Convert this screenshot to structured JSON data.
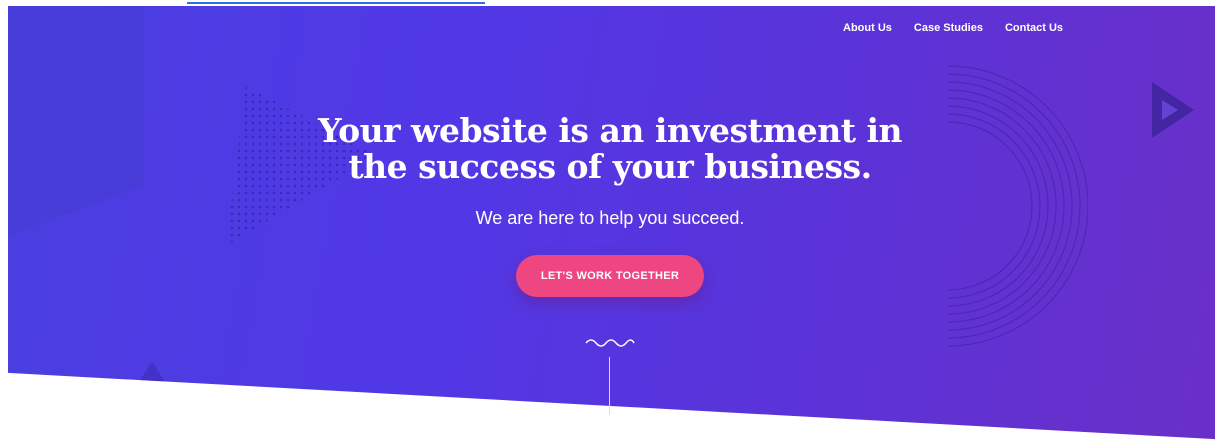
{
  "nav": {
    "items": [
      {
        "label": "About Us"
      },
      {
        "label": "Case Studies"
      },
      {
        "label": "Contact Us"
      }
    ]
  },
  "hero": {
    "headline_line1": "Your website is an investment in",
    "headline_line2": "the success of your business.",
    "subhead": "We are here to help you succeed.",
    "cta_label": "LET'S WORK TOGETHER"
  },
  "colors": {
    "hero_gradient_start": "#4a3fe0",
    "hero_gradient_end": "#6a2fc8",
    "cta_background": "#ee4681",
    "top_link_underline": "#2f6fe0",
    "text": "#ffffff"
  },
  "icons": {
    "scroll_indicator": "squiggle-icon",
    "decorative_play": "play-triangle-icon"
  }
}
